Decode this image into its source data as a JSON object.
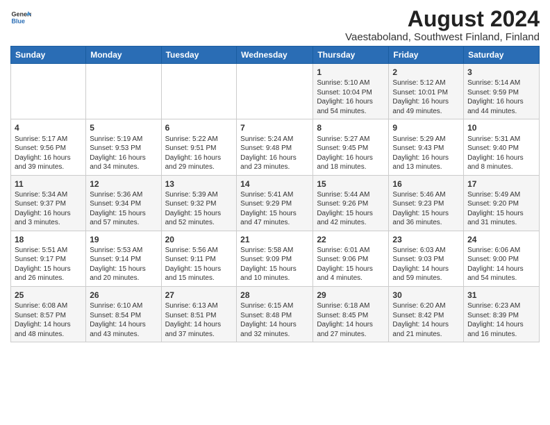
{
  "logo": {
    "general": "General",
    "blue": "Blue"
  },
  "title": "August 2024",
  "subtitle": "Vaestaboland, Southwest Finland, Finland",
  "weekdays": [
    "Sunday",
    "Monday",
    "Tuesday",
    "Wednesday",
    "Thursday",
    "Friday",
    "Saturday"
  ],
  "weeks": [
    [
      {
        "day": "",
        "content": ""
      },
      {
        "day": "",
        "content": ""
      },
      {
        "day": "",
        "content": ""
      },
      {
        "day": "",
        "content": ""
      },
      {
        "day": "1",
        "content": "Sunrise: 5:10 AM\nSunset: 10:04 PM\nDaylight: 16 hours\nand 54 minutes."
      },
      {
        "day": "2",
        "content": "Sunrise: 5:12 AM\nSunset: 10:01 PM\nDaylight: 16 hours\nand 49 minutes."
      },
      {
        "day": "3",
        "content": "Sunrise: 5:14 AM\nSunset: 9:59 PM\nDaylight: 16 hours\nand 44 minutes."
      }
    ],
    [
      {
        "day": "4",
        "content": "Sunrise: 5:17 AM\nSunset: 9:56 PM\nDaylight: 16 hours\nand 39 minutes."
      },
      {
        "day": "5",
        "content": "Sunrise: 5:19 AM\nSunset: 9:53 PM\nDaylight: 16 hours\nand 34 minutes."
      },
      {
        "day": "6",
        "content": "Sunrise: 5:22 AM\nSunset: 9:51 PM\nDaylight: 16 hours\nand 29 minutes."
      },
      {
        "day": "7",
        "content": "Sunrise: 5:24 AM\nSunset: 9:48 PM\nDaylight: 16 hours\nand 23 minutes."
      },
      {
        "day": "8",
        "content": "Sunrise: 5:27 AM\nSunset: 9:45 PM\nDaylight: 16 hours\nand 18 minutes."
      },
      {
        "day": "9",
        "content": "Sunrise: 5:29 AM\nSunset: 9:43 PM\nDaylight: 16 hours\nand 13 minutes."
      },
      {
        "day": "10",
        "content": "Sunrise: 5:31 AM\nSunset: 9:40 PM\nDaylight: 16 hours\nand 8 minutes."
      }
    ],
    [
      {
        "day": "11",
        "content": "Sunrise: 5:34 AM\nSunset: 9:37 PM\nDaylight: 16 hours\nand 3 minutes."
      },
      {
        "day": "12",
        "content": "Sunrise: 5:36 AM\nSunset: 9:34 PM\nDaylight: 15 hours\nand 57 minutes."
      },
      {
        "day": "13",
        "content": "Sunrise: 5:39 AM\nSunset: 9:32 PM\nDaylight: 15 hours\nand 52 minutes."
      },
      {
        "day": "14",
        "content": "Sunrise: 5:41 AM\nSunset: 9:29 PM\nDaylight: 15 hours\nand 47 minutes."
      },
      {
        "day": "15",
        "content": "Sunrise: 5:44 AM\nSunset: 9:26 PM\nDaylight: 15 hours\nand 42 minutes."
      },
      {
        "day": "16",
        "content": "Sunrise: 5:46 AM\nSunset: 9:23 PM\nDaylight: 15 hours\nand 36 minutes."
      },
      {
        "day": "17",
        "content": "Sunrise: 5:49 AM\nSunset: 9:20 PM\nDaylight: 15 hours\nand 31 minutes."
      }
    ],
    [
      {
        "day": "18",
        "content": "Sunrise: 5:51 AM\nSunset: 9:17 PM\nDaylight: 15 hours\nand 26 minutes."
      },
      {
        "day": "19",
        "content": "Sunrise: 5:53 AM\nSunset: 9:14 PM\nDaylight: 15 hours\nand 20 minutes."
      },
      {
        "day": "20",
        "content": "Sunrise: 5:56 AM\nSunset: 9:11 PM\nDaylight: 15 hours\nand 15 minutes."
      },
      {
        "day": "21",
        "content": "Sunrise: 5:58 AM\nSunset: 9:09 PM\nDaylight: 15 hours\nand 10 minutes."
      },
      {
        "day": "22",
        "content": "Sunrise: 6:01 AM\nSunset: 9:06 PM\nDaylight: 15 hours\nand 4 minutes."
      },
      {
        "day": "23",
        "content": "Sunrise: 6:03 AM\nSunset: 9:03 PM\nDaylight: 14 hours\nand 59 minutes."
      },
      {
        "day": "24",
        "content": "Sunrise: 6:06 AM\nSunset: 9:00 PM\nDaylight: 14 hours\nand 54 minutes."
      }
    ],
    [
      {
        "day": "25",
        "content": "Sunrise: 6:08 AM\nSunset: 8:57 PM\nDaylight: 14 hours\nand 48 minutes."
      },
      {
        "day": "26",
        "content": "Sunrise: 6:10 AM\nSunset: 8:54 PM\nDaylight: 14 hours\nand 43 minutes."
      },
      {
        "day": "27",
        "content": "Sunrise: 6:13 AM\nSunset: 8:51 PM\nDaylight: 14 hours\nand 37 minutes."
      },
      {
        "day": "28",
        "content": "Sunrise: 6:15 AM\nSunset: 8:48 PM\nDaylight: 14 hours\nand 32 minutes."
      },
      {
        "day": "29",
        "content": "Sunrise: 6:18 AM\nSunset: 8:45 PM\nDaylight: 14 hours\nand 27 minutes."
      },
      {
        "day": "30",
        "content": "Sunrise: 6:20 AM\nSunset: 8:42 PM\nDaylight: 14 hours\nand 21 minutes."
      },
      {
        "day": "31",
        "content": "Sunrise: 6:23 AM\nSunset: 8:39 PM\nDaylight: 14 hours\nand 16 minutes."
      }
    ]
  ]
}
